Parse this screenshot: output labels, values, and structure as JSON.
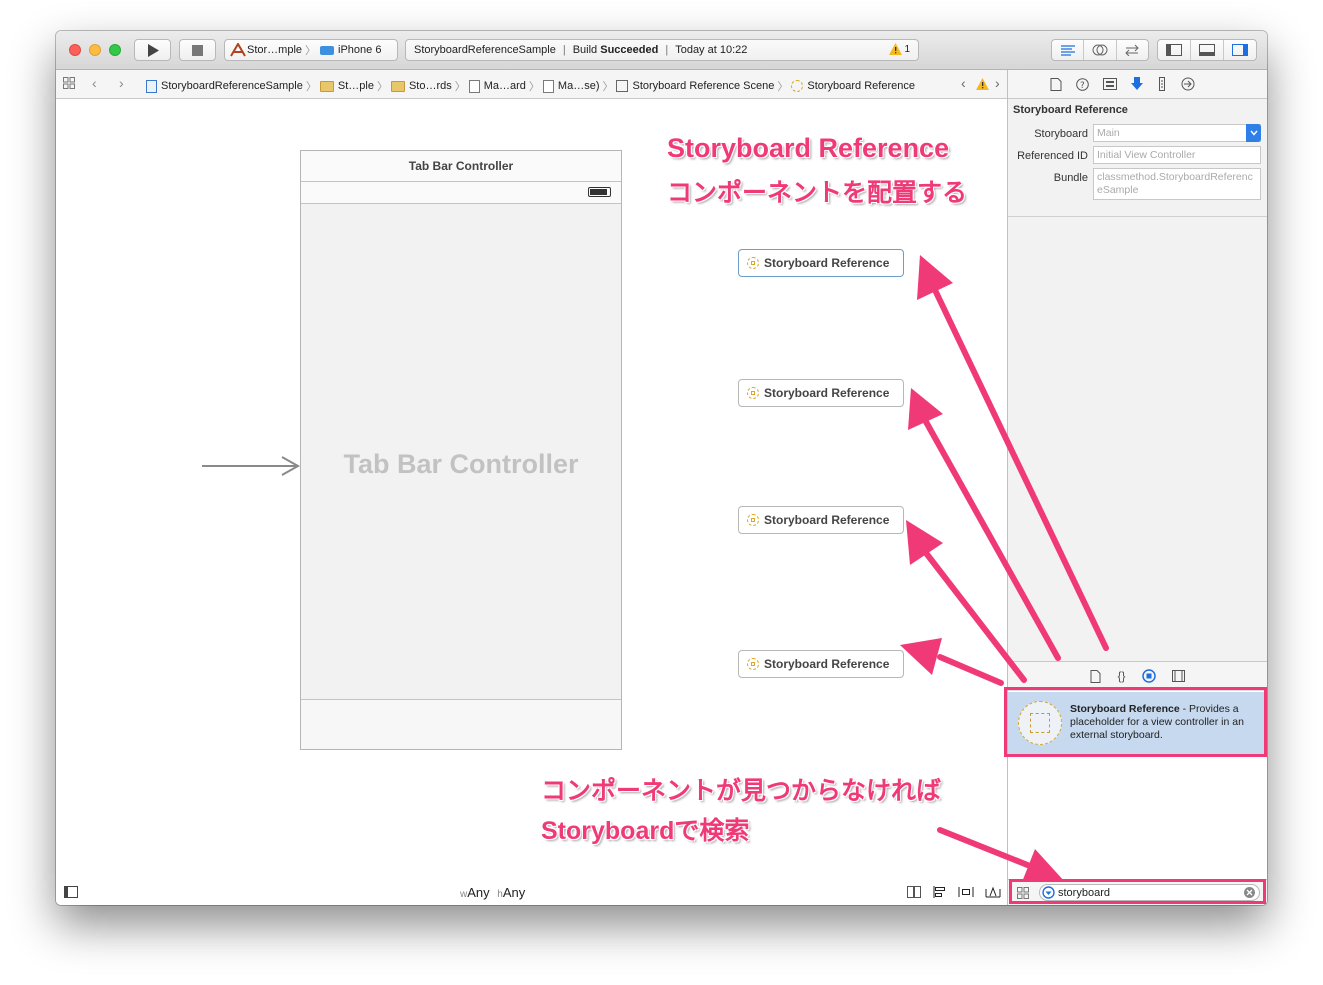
{
  "toolbar": {
    "scheme_target": "Stor…mple",
    "device": "iPhone 6",
    "activity_project": "StoryboardReferenceSample",
    "activity_status_prefix": "Build ",
    "activity_status": "Succeeded",
    "activity_time": "Today at 10:22",
    "warning_count": "1"
  },
  "jumpbar": {
    "items": [
      "StoryboardReferenceSample",
      "St…ple",
      "Sto…rds",
      "Ma…ard",
      "Ma…se)",
      "Storyboard Reference Scene",
      "Storyboard Reference"
    ]
  },
  "canvas": {
    "tab_bar_title": "Tab Bar Controller",
    "tab_bar_center": "Tab Bar Controller",
    "storyboard_refs": [
      "Storyboard Reference",
      "Storyboard Reference",
      "Storyboard Reference",
      "Storyboard Reference"
    ],
    "size_class_w_prefix": "w",
    "size_class_w": "Any",
    "size_class_h_prefix": "h",
    "size_class_h": "Any"
  },
  "annotations": {
    "top_line1": "Storyboard Reference",
    "top_line2": "コンポーネントを配置する",
    "bottom_line1": "コンポーネントが見つからなければ",
    "bottom_line2": "Storyboardで検索",
    "color": "#f03a78"
  },
  "inspector": {
    "section_title": "Storyboard Reference",
    "storyboard_label": "Storyboard",
    "storyboard_value": "Main",
    "referenced_id_label": "Referenced ID",
    "referenced_id_placeholder": "Initial View Controller",
    "bundle_label": "Bundle",
    "bundle_placeholder": "classmethod.StoryboardReferenceSample"
  },
  "library": {
    "item_title": "Storyboard Reference",
    "item_desc": " - Provides a placeholder for a view controller in an external storyboard.",
    "search_value": "storyboard"
  }
}
